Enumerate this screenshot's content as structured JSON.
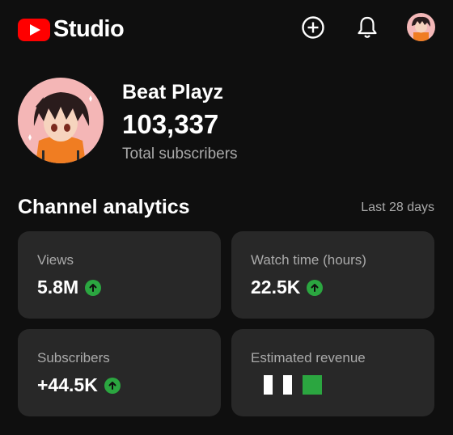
{
  "header": {
    "app_name": "Studio",
    "logo_icon": "youtube-logo-icon",
    "create_icon": "plus-circle-icon",
    "notifications_icon": "bell-icon",
    "avatar_icon": "profile-avatar"
  },
  "channel": {
    "name": "Beat Playz",
    "subscriber_count": "103,337",
    "subscriber_label": "Total subscribers"
  },
  "analytics": {
    "title": "Channel analytics",
    "period": "Last 28 days",
    "cards": [
      {
        "label": "Views",
        "value": "5.8M",
        "trend": "up"
      },
      {
        "label": "Watch time (hours)",
        "value": "22.5K",
        "trend": "up"
      },
      {
        "label": "Subscribers",
        "value": "+44.5K",
        "trend": "up"
      },
      {
        "label": "Estimated revenue",
        "value": ""
      }
    ]
  },
  "colors": {
    "background": "#0f0f0f",
    "card": "#282828",
    "brand_red": "#ff0000",
    "trend_green": "#2ba640",
    "secondary_text": "#aaaaaa"
  }
}
